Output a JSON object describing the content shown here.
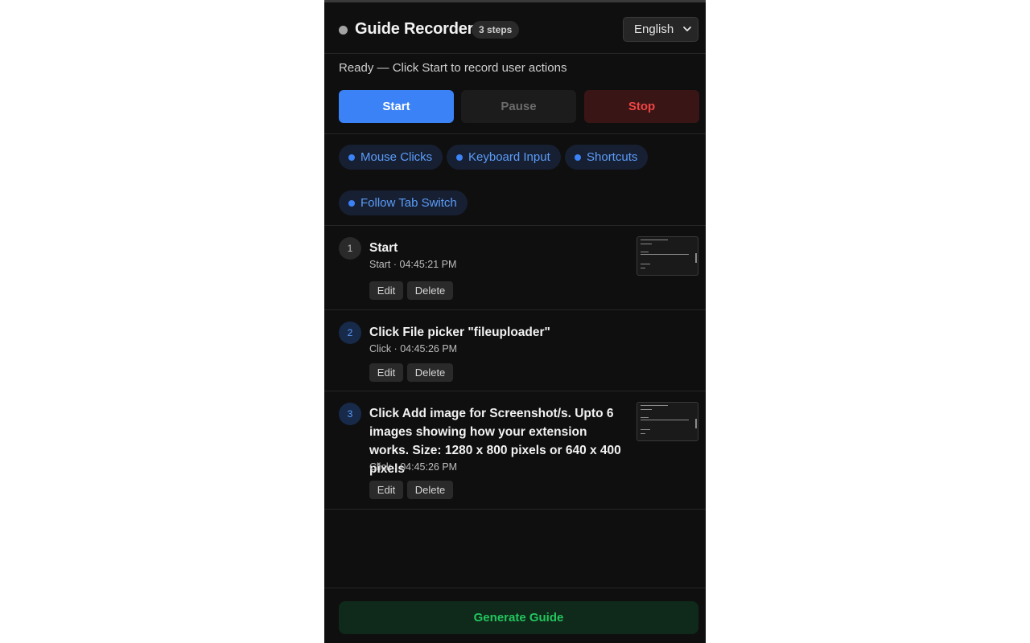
{
  "header": {
    "title": "Guide Recorder",
    "steps_badge": "3 steps",
    "language": "English",
    "status_dot_color": "#a3a3a3"
  },
  "controls": {
    "status": "Ready — Click Start to record user actions",
    "start_label": "Start",
    "pause_label": "Pause",
    "stop_label": "Stop"
  },
  "options": [
    "Mouse Clicks",
    "Keyboard Input",
    "Shortcuts",
    "Follow Tab Switch"
  ],
  "steps": [
    {
      "number": "1",
      "title": "Start",
      "meta": "Start · 04:45:21 PM",
      "edit_label": "Edit",
      "delete_label": "Delete",
      "has_thumbnail": true
    },
    {
      "number": "2",
      "title": "Click File picker \"fileuploader\"",
      "meta": "Click · 04:45:26 PM",
      "edit_label": "Edit",
      "delete_label": "Delete",
      "has_thumbnail": false
    },
    {
      "number": "3",
      "title": "Click Add image for Screenshot/s. Upto 6 images showing how your extension works. Size: 1280 x 800 pixels or 640 x 400 pixels",
      "meta": "Click · 04:45:26 PM",
      "edit_label": "Edit",
      "delete_label": "Delete",
      "has_thumbnail": true
    }
  ],
  "footer": {
    "generate_label": "Generate Guide"
  },
  "colors": {
    "accent": "#3b82f6",
    "stop": "#ef4444",
    "generate": "#22c55e",
    "background": "#0f0f0f"
  }
}
